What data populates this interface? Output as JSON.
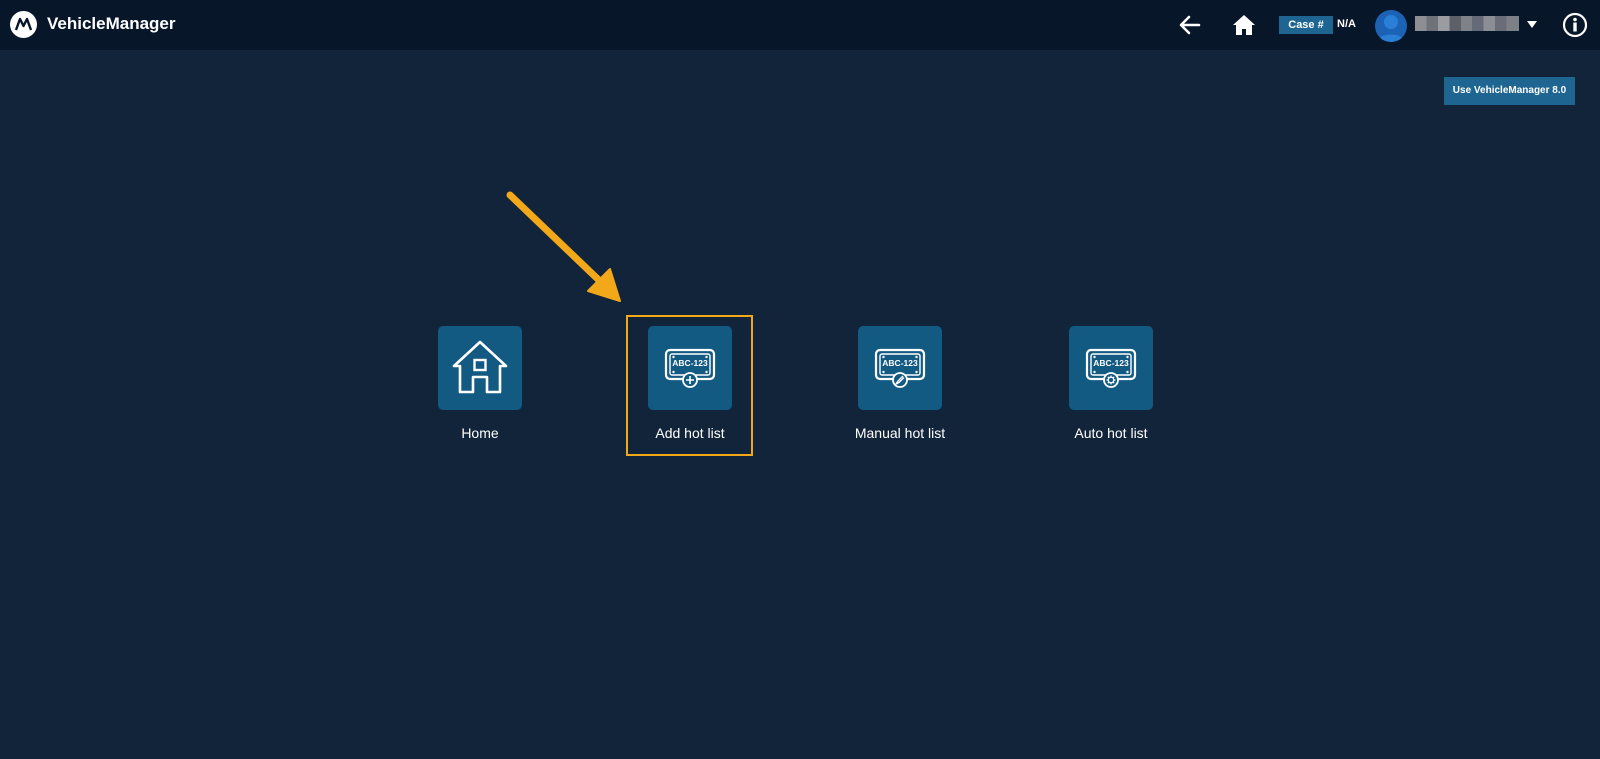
{
  "app": {
    "title": "VehicleManager"
  },
  "header": {
    "case_label": "Case #",
    "case_value": "N/A",
    "icons": [
      "back-arrow-icon",
      "home-icon",
      "user-avatar-icon",
      "chevron-down-icon",
      "info-icon"
    ]
  },
  "legacy_button_label": "Use VehicleManager 8.0",
  "tiles": [
    {
      "label": "Home",
      "icon": "house-icon"
    },
    {
      "label": "Add hot list",
      "icon": "license-plate-add-icon",
      "plate_text": "ABC-123"
    },
    {
      "label": "Manual hot list",
      "icon": "license-plate-manual-icon",
      "plate_text": "ABC-123"
    },
    {
      "label": "Auto hot list",
      "icon": "license-plate-auto-icon",
      "plate_text": "ABC-123"
    }
  ],
  "colors": {
    "background": "#12243a",
    "topbar": "#071629",
    "accent": "#1e6691",
    "tile": "#135a83",
    "highlight": "#f3a81a"
  }
}
